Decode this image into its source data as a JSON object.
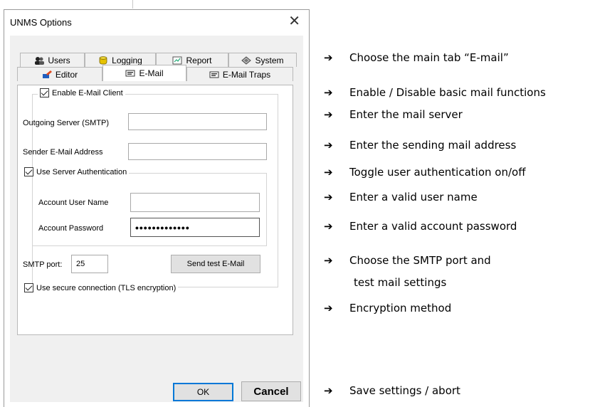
{
  "window": {
    "title": "UNMS Options",
    "close_glyph": "✕"
  },
  "tabs_row1": [
    {
      "label": "Users",
      "icon": "users-icon"
    },
    {
      "label": "Logging",
      "icon": "database-icon"
    },
    {
      "label": "Report",
      "icon": "report-icon"
    },
    {
      "label": "System",
      "icon": "system-icon"
    }
  ],
  "tabs_row2": [
    {
      "label": "Editor",
      "icon": "editor-icon"
    },
    {
      "label": "E-Mail",
      "icon": "email-icon",
      "active": true
    },
    {
      "label": "E-Mail Traps",
      "icon": "email-traps-icon"
    }
  ],
  "email": {
    "enable_client_label": "Enable E-Mail Client",
    "enable_client_checked": true,
    "outgoing_server_label": "Outgoing Server (SMTP)",
    "outgoing_server_value": "",
    "sender_address_label": "Sender E-Mail Address",
    "sender_address_value": "",
    "use_auth_label": "Use Server Authentication",
    "use_auth_checked": true,
    "account_user_label": "Account User Name",
    "account_user_value": "",
    "account_password_label": "Account Password",
    "account_password_value": "•••••••••••••",
    "smtp_port_label": "SMTP port:",
    "smtp_port_value": "25",
    "send_test_label": "Send test E-Mail",
    "secure_label": "Use secure connection (TLS encryption)",
    "secure_checked": true
  },
  "footer": {
    "ok_label": "OK",
    "cancel_label": "Cancel"
  },
  "annotations": [
    "Choose the main tab “E-mail”",
    "Enable / Disable basic mail functions",
    "Enter the mail server",
    "Enter the sending mail address",
    "Toggle user authentication on/off",
    "Enter a valid user name",
    "Enter a valid account password",
    "Choose the SMTP port and",
    "test mail settings",
    "Encryption method",
    "Save settings / abort"
  ],
  "colors": {
    "accent": "#0078d7",
    "dialog_bg": "#f0f0f0",
    "database_icon": "#e6c200"
  }
}
